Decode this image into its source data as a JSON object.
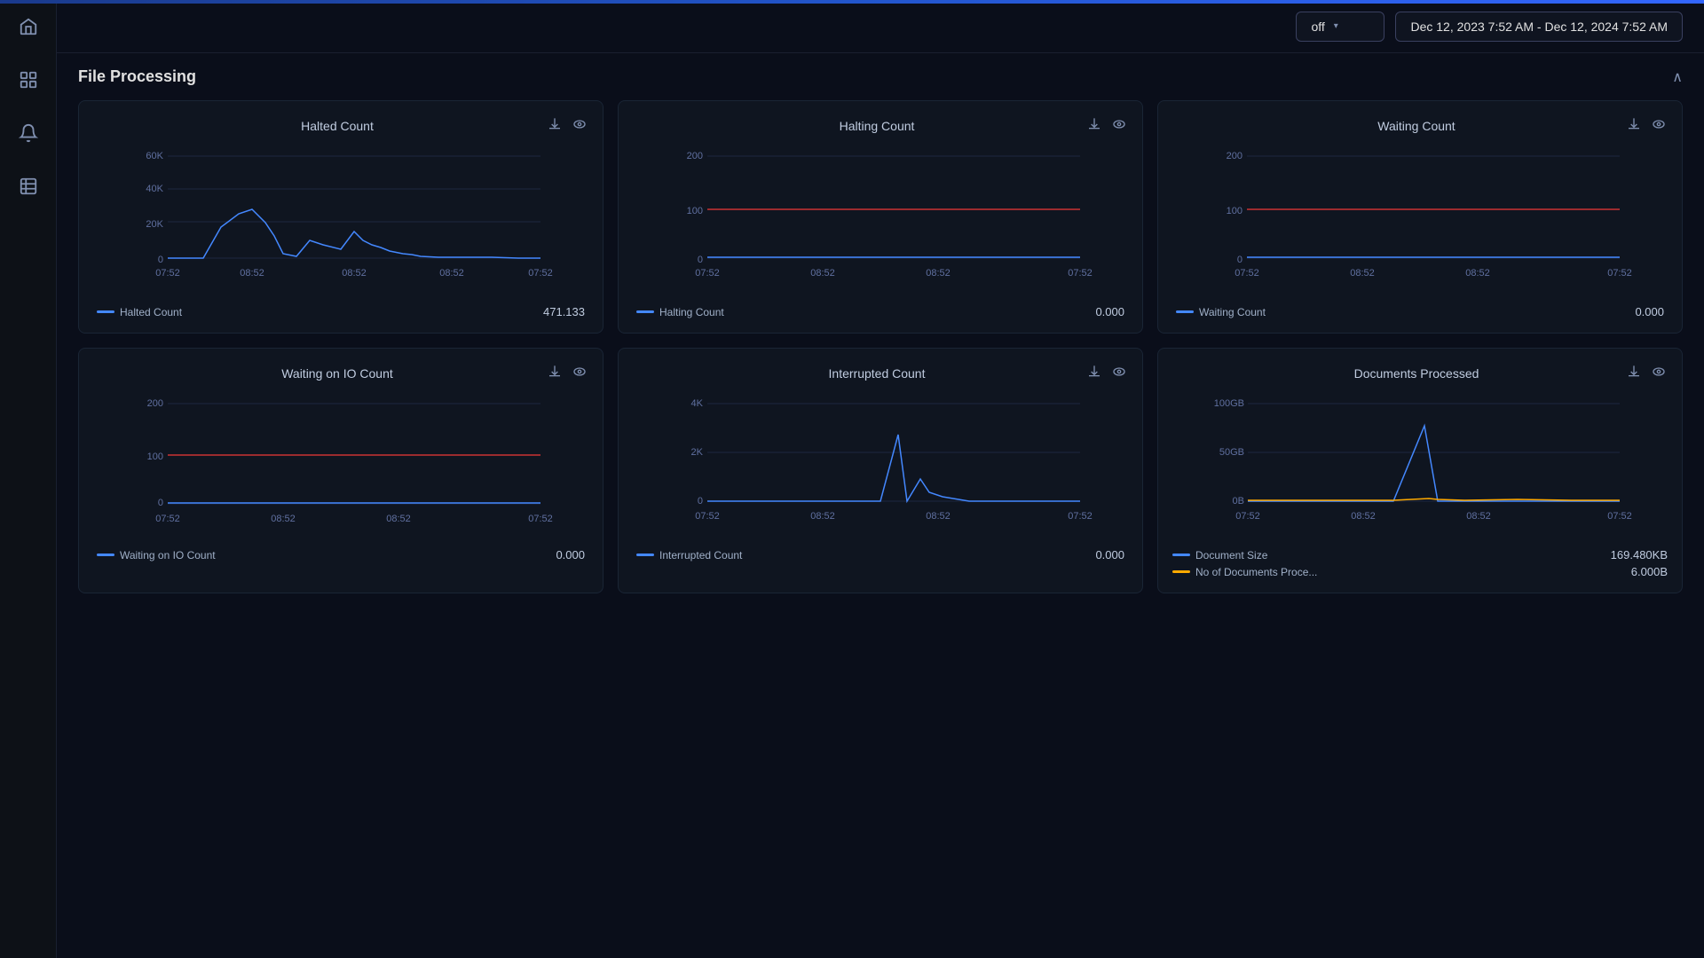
{
  "accent": "#2255cc",
  "header": {
    "dropdown_label": "off",
    "dropdown_chevron": "▾",
    "date_range": "Dec 12, 2023 7:52 AM - Dec 12, 2024 7:52 AM"
  },
  "sidebar": {
    "items": [
      {
        "label": "home",
        "icon": "⌂"
      },
      {
        "label": "grid",
        "icon": "⊞"
      },
      {
        "label": "bell",
        "icon": "🔔"
      },
      {
        "label": "book",
        "icon": "📋"
      }
    ]
  },
  "section": {
    "title": "File Processing",
    "collapse_icon": "∧"
  },
  "charts_row1": [
    {
      "title": "Halted Count",
      "legend_label": "Halted Count",
      "legend_color": "#4488ff",
      "legend_value": "471.133",
      "y_labels": [
        "60K",
        "40K",
        "20K",
        "0"
      ],
      "x_labels": [
        "07:52",
        "08:52",
        "08:52",
        "08:52",
        "07:52"
      ],
      "has_red_line": false,
      "chart_type": "halted"
    },
    {
      "title": "Halting Count",
      "legend_label": "Halting Count",
      "legend_color": "#4488ff",
      "legend_value": "0.000",
      "y_labels": [
        "200",
        "100",
        "0"
      ],
      "x_labels": [
        "07:52",
        "08:52",
        "08:52",
        "07:52"
      ],
      "has_red_line": true,
      "chart_type": "flat"
    },
    {
      "title": "Waiting Count",
      "legend_label": "Waiting Count",
      "legend_color": "#4488ff",
      "legend_value": "0.000",
      "y_labels": [
        "200",
        "100",
        "0"
      ],
      "x_labels": [
        "07:52",
        "08:52",
        "08:52",
        "07:52"
      ],
      "has_red_line": true,
      "chart_type": "flat"
    }
  ],
  "charts_row2": [
    {
      "title": "Waiting on IO Count",
      "legend_label": "Waiting on IO Count",
      "legend_color": "#4488ff",
      "legend_value": "0.000",
      "y_labels": [
        "200",
        "100",
        "0"
      ],
      "x_labels": [
        "07:52",
        "08:52",
        "08:52",
        "07:52"
      ],
      "has_red_line": true,
      "chart_type": "flat"
    },
    {
      "title": "Interrupted Count",
      "legend_label": "Interrupted Count",
      "legend_color": "#4488ff",
      "legend_value": "0.000",
      "y_labels": [
        "4K",
        "2K",
        "0"
      ],
      "x_labels": [
        "07:52",
        "08:52",
        "08:52",
        "07:52"
      ],
      "has_red_line": false,
      "chart_type": "interrupted"
    },
    {
      "title": "Documents Processed",
      "legend_label1": "Document Size",
      "legend_label2": "No of Documents Proce...",
      "legend_color1": "#4488ff",
      "legend_color2": "#ffaa00",
      "legend_value1": "169.480KB",
      "legend_value2": "6.000B",
      "y_labels": [
        "100GB",
        "50GB",
        "0B"
      ],
      "x_labels": [
        "07:52",
        "08:52",
        "08:52",
        "07:52"
      ],
      "has_red_line": false,
      "chart_type": "documents"
    }
  ],
  "icons": {
    "download": "⬇",
    "eye": "👁",
    "home": "⌂",
    "grid": "▦",
    "bell": "🔔",
    "book": "📋"
  }
}
